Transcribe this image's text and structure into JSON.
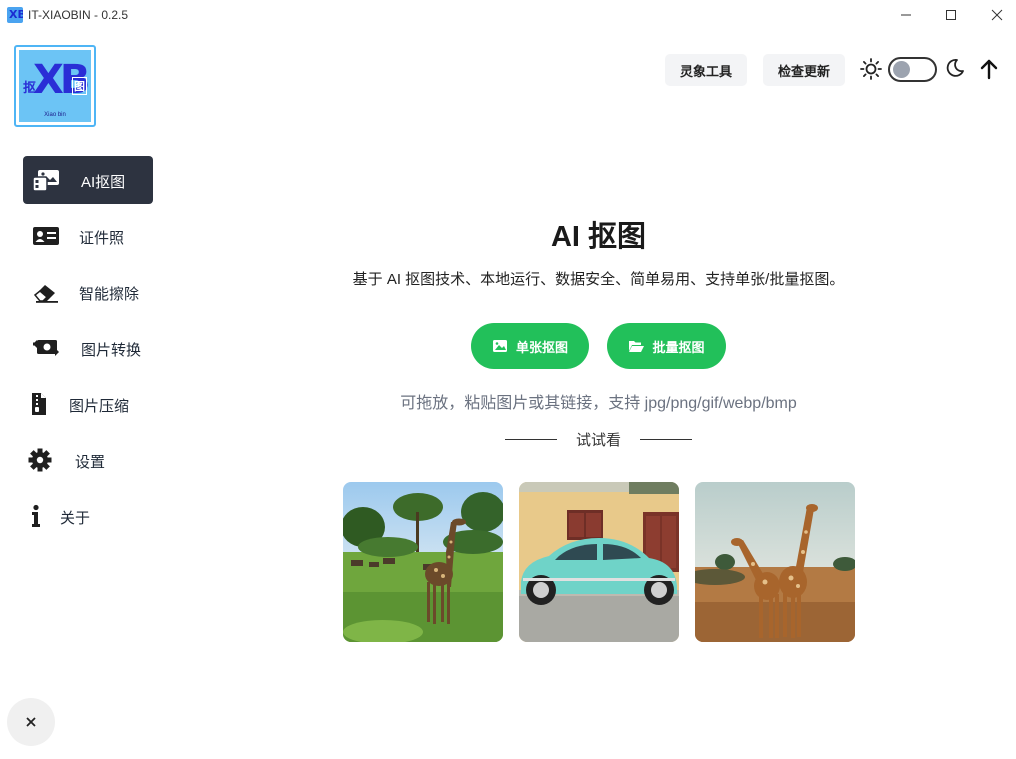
{
  "window": {
    "title": "IT-XIAOBIN - 0.2.5",
    "icon": "app-logo-icon"
  },
  "logo": {
    "big_text": "XB",
    "left_char": "抠",
    "right_char": "图",
    "sub_text": "Xiao bin"
  },
  "sidebar": {
    "items": [
      {
        "label": "AI抠图",
        "icon": "image-stack-icon",
        "active": true
      },
      {
        "label": "证件照",
        "icon": "id-card-icon",
        "active": false
      },
      {
        "label": "智能擦除",
        "icon": "eraser-icon",
        "active": false
      },
      {
        "label": "图片转换",
        "icon": "money-exchange-icon",
        "active": false
      },
      {
        "label": "图片压缩",
        "icon": "zip-file-icon",
        "active": false
      },
      {
        "label": "设置",
        "icon": "gear-icon",
        "active": false
      },
      {
        "label": "关于",
        "icon": "info-icon",
        "active": false
      }
    ]
  },
  "toolbar": {
    "tool_label": "灵象工具",
    "update_label": "检查更新"
  },
  "main": {
    "title": "AI 抠图",
    "description": "基于 AI 抠图技术、本地运行、数据安全、简单易用、支持单张/批量抠图。",
    "single_button": "单张抠图",
    "batch_button": "批量抠图",
    "hint": "可拖放，粘贴图片或其链接，支持 jpg/png/gif/webp/bmp",
    "try_label": "试试看"
  },
  "colors": {
    "accent_green": "#22c05a",
    "active_nav": "#2d3340"
  }
}
